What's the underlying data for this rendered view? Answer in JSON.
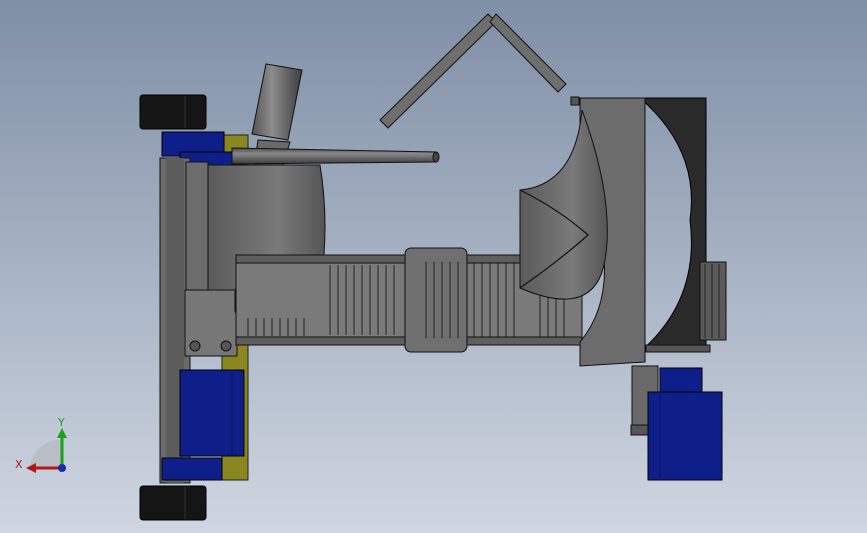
{
  "viewport": {
    "background_top": "#7f8fa6",
    "background_bottom": "#cfd6e1"
  },
  "triad": {
    "x_label": "X",
    "y_label": "Y",
    "x_color": "#b01818",
    "y_color": "#1aa01a",
    "z_color": "#1a2aa8"
  },
  "colors": {
    "motor_blue": "#0f1f8a",
    "plate_yellow": "#8a8620",
    "body_gray": "#6e6e6e",
    "dark_gray": "#3a3a3a",
    "tire_black": "#151515",
    "edge": "#111111"
  }
}
